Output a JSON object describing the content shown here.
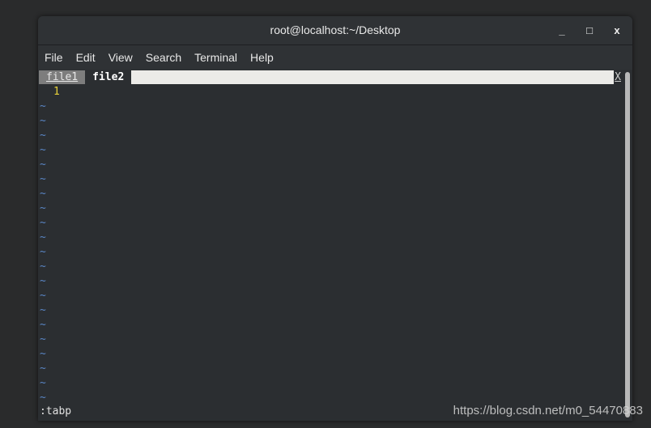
{
  "window": {
    "title": "root@localhost:~/Desktop",
    "minimize": "_",
    "maximize": "□",
    "close": "x"
  },
  "menu": [
    "File",
    "Edit",
    "View",
    "Search",
    "Terminal",
    "Help"
  ],
  "tabs": {
    "items": [
      "file1",
      "file2"
    ],
    "active": 1,
    "close": "X"
  },
  "buffer": {
    "line_number": "1",
    "tilde": "~",
    "tilde_count": 21
  },
  "command": ":tabp",
  "watermark": "https://blog.csdn.net/m0_54470883",
  "colors": {
    "line_number": "#e8d23a",
    "tilde": "#5a86c6",
    "background": "#2b2e31"
  }
}
